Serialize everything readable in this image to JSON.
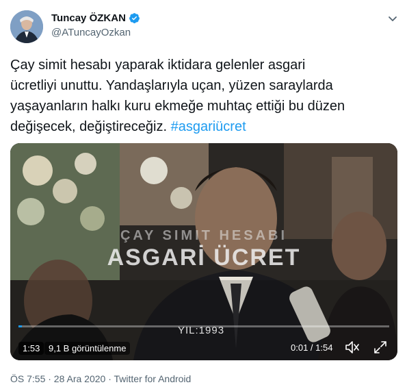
{
  "author": {
    "name": "Tuncay ÖZKAN",
    "handle": "@ATuncayOzkan",
    "verified": true,
    "avatar_icon": "avatar-photo"
  },
  "tweet": {
    "text": "Çay simit hesabı yaparak iktidara gelenler asgari\nücretliyi unuttu. Yandaşlarıyla uçan, yüzen saraylarda\nyaşayanların halkı kuru ekmeğe muhtaç ettiği bu düzen\ndeğişecek, değiştireceğiz. ",
    "hashtag": "#asgariücret"
  },
  "video": {
    "overlay_line1": "ÇAY SIMIT HESABI",
    "overlay_line2": "ASGARİ ÜCRET",
    "overlay_year": "YIL:1993",
    "duration_badge": "1:53",
    "views": "9,1 B görüntülenme",
    "timecode": "0:01 / 1:54",
    "progress_fraction": 0.01
  },
  "meta": {
    "line": "ÖS 7:55 · 28 Ara 2020 · Twitter for Android"
  },
  "colors": {
    "link": "#1d9bf0",
    "verified": "#1d9bf0",
    "muted_text": "#536471"
  }
}
